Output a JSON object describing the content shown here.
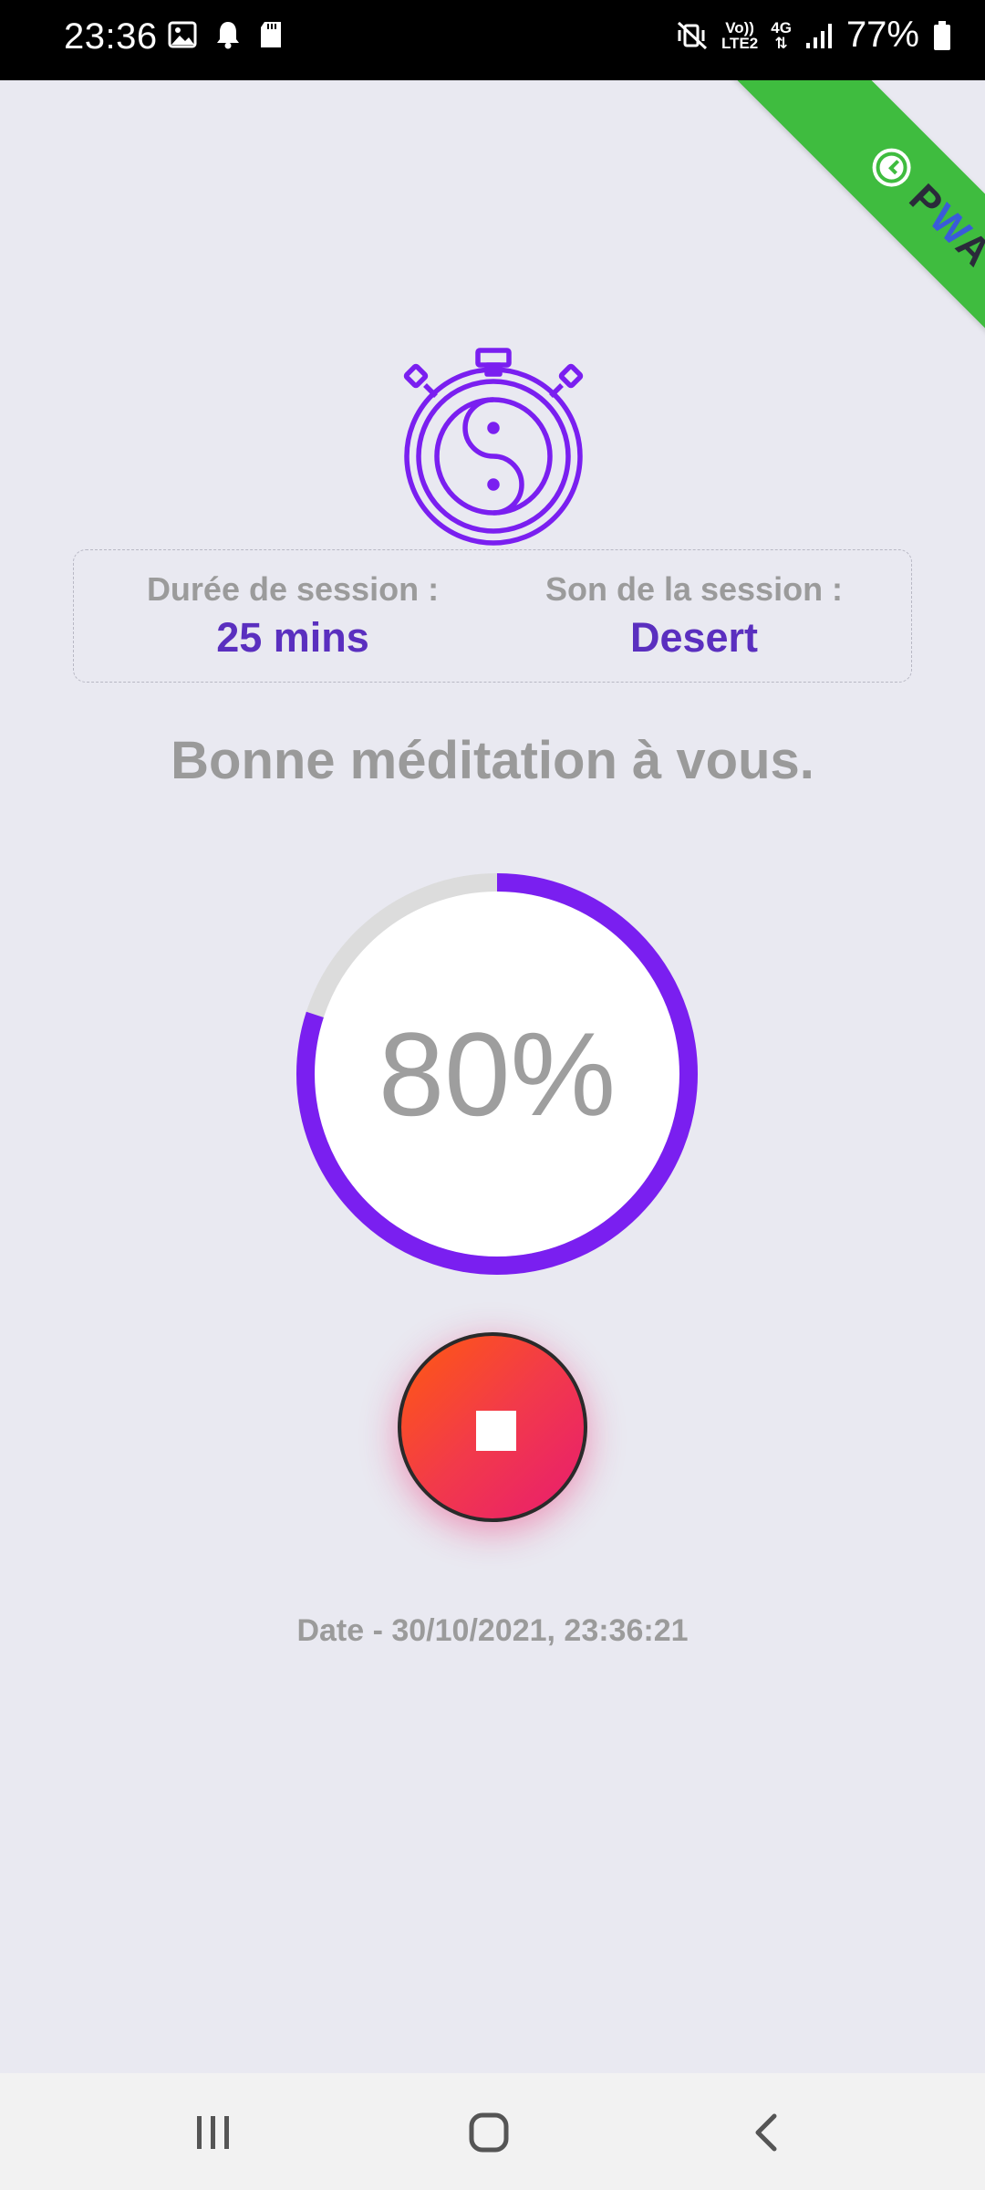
{
  "status_bar": {
    "time": "23:36",
    "left_icons": [
      "image-icon",
      "bell-icon",
      "sd-card-icon"
    ],
    "volte_top": "Vo))",
    "volte_bottom": "LTE2",
    "network": "4G",
    "battery_percent": "77%",
    "right_icons": [
      "mute-vibrate-icon",
      "signal-icon",
      "battery-icon"
    ]
  },
  "ribbon": {
    "label_p": "P",
    "label_w": "W",
    "label_a": "A",
    "icon": "clock-icon"
  },
  "session": {
    "duration_label": "Durée de session :",
    "duration_value": "25 mins",
    "sound_label": "Son de la session :",
    "sound_value": "Desert"
  },
  "greeting": "Bonne méditation à vous.",
  "progress": {
    "text": "80%",
    "fraction": 0.8
  },
  "stop_button": {
    "icon": "stop-icon"
  },
  "date_line": "Date - 30/10/2021, 23:36:21",
  "colors": {
    "accent": "#7a1ff0",
    "value_text": "#5a2fbf",
    "ribbon": "#3fbc3f",
    "background": "#e9e9f1"
  },
  "nav_bar": {
    "icons": [
      "recent-apps-icon",
      "home-icon",
      "back-icon"
    ]
  }
}
